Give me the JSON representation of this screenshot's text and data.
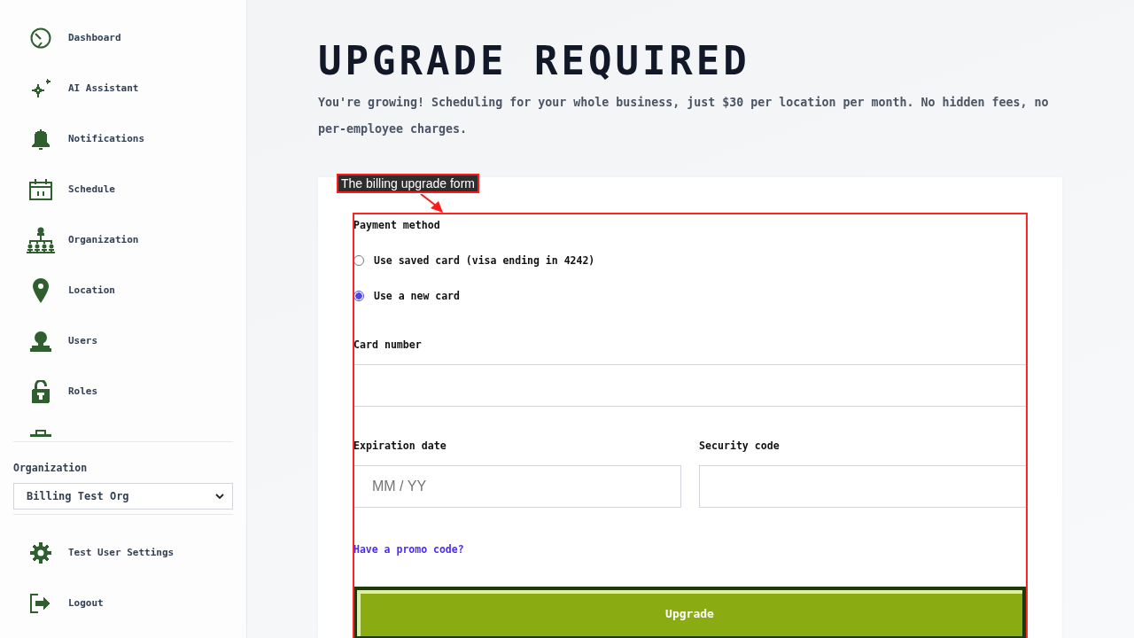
{
  "sidebar": {
    "nav_items": [
      {
        "kind": "link",
        "label": "Dashboard"
      },
      {
        "kind": "link",
        "label": "AI Assistant"
      },
      {
        "kind": "link",
        "label": "Notifications"
      },
      {
        "kind": "link",
        "label": "Schedule"
      },
      {
        "kind": "link",
        "label": "Organization"
      },
      {
        "kind": "link",
        "label": "Location"
      },
      {
        "kind": "link",
        "label": "Users"
      },
      {
        "kind": "link",
        "label": "Roles"
      },
      {
        "kind": "partial"
      }
    ],
    "org_switcher": {
      "label": "Organization",
      "value": "Billing Test Org"
    },
    "footer_items": [
      {
        "label": "Test User Settings"
      },
      {
        "label": "Logout"
      }
    ]
  },
  "page": {
    "title": "UPGRADE REQUIRED",
    "description": "You're growing! Scheduling for your whole business, just $30 per location per month. No hidden fees, no per-employee charges."
  },
  "annotation": {
    "label": "The billing upgrade form"
  },
  "billing_form": {
    "payment_method": {
      "label": "Payment method",
      "options": [
        {
          "label": "Use saved card (visa ending in 4242)",
          "selected": false
        },
        {
          "label": "Use a new card",
          "selected": true
        }
      ]
    },
    "card_number": {
      "label": "Card number"
    },
    "expiration_date": {
      "label": "Expiration date",
      "placeholder": "MM / YY"
    },
    "security_code": {
      "label": "Security code"
    },
    "promo_link": "Have a promo code?",
    "submit_button": "Upgrade"
  }
}
